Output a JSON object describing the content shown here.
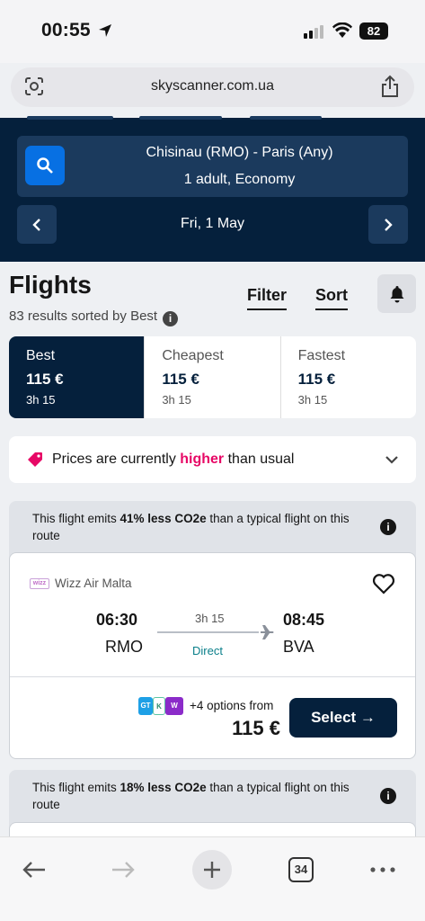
{
  "status": {
    "time": "00:55",
    "battery": "82"
  },
  "browser": {
    "domain": "skyscanner.com.ua",
    "tabs_count": "34"
  },
  "search": {
    "route": "Chisinau (RMO) - Paris (Any)",
    "passengers": "1 adult, Economy",
    "date": "Fri, 1 May"
  },
  "results": {
    "title": "Flights",
    "summary": "83 results sorted by Best",
    "filter_label": "Filter",
    "sort_label": "Sort"
  },
  "sort_tabs": [
    {
      "name": "Best",
      "price": "115 €",
      "duration": "3h 15"
    },
    {
      "name": "Cheapest",
      "price": "115 €",
      "duration": "3h 15"
    },
    {
      "name": "Fastest",
      "price": "115 €",
      "duration": "3h 15"
    }
  ],
  "price_alert": {
    "before": "Prices are currently ",
    "highlight": "higher",
    "after": " than usual"
  },
  "flights": [
    {
      "eco_before": "This flight emits ",
      "eco_bold": "41% less CO2e",
      "eco_after": " than a typical flight on this route",
      "airline": "Wizz Air Malta",
      "depart_time": "06:30",
      "depart_code": "RMO",
      "arrive_time": "08:45",
      "arrive_code": "BVA",
      "duration": "3h 15",
      "stops": "Direct",
      "options": "+4 options from",
      "price": "115 €",
      "select_label": "Select →"
    },
    {
      "eco_before": "This flight emits ",
      "eco_bold": "18% less CO2e",
      "eco_after": " than a typical flight on this route"
    }
  ],
  "colors": {
    "brand_dark": "#05203c",
    "brand_blue": "#0770e3",
    "highlight_pink": "#e70866",
    "direct_teal": "#0a7f8a"
  }
}
